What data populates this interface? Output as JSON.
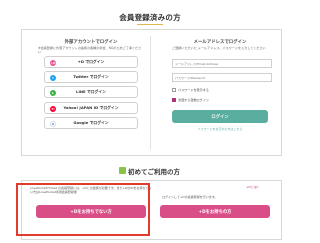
{
  "page": {
    "member_title": "会員登録済みの方",
    "first_title": "初めてご利用の方"
  },
  "external": {
    "heading": "外部アカウントでログイン",
    "desc": "※会員登録に外部アカウントの連携の各種の場合、NGのためご了承ください",
    "buttons": [
      {
        "label": "+D でログイン",
        "icon": "plus-d-icon",
        "color": "#e85a95",
        "glyph": "+D"
      },
      {
        "label": "Twitter でログイン",
        "icon": "twitter-icon",
        "color": "#1da1f2",
        "glyph": "t"
      },
      {
        "label": "LINE でログイン",
        "icon": "line-icon",
        "color": "#3cb44a",
        "glyph": "L"
      },
      {
        "label": "Yahoo! JAPAN ID でログイン",
        "icon": "yahoo-icon",
        "color": "#ff0033",
        "glyph": "Y!"
      },
      {
        "label": "Google でログイン",
        "icon": "google-icon",
        "color": "#ffffff",
        "glyph": "G"
      }
    ]
  },
  "email": {
    "heading": "メールアドレスでログイン",
    "desc": "ご登録いただいた メールアドレス、パスワードを入力してください",
    "email_placeholder": "メールアドレス/Email Address",
    "password_placeholder": "パスワード/Password",
    "show_password_label": "パスワードを表示する",
    "keep_login_label": "次回から自動ログイン",
    "login_button": "ログイン",
    "forgot_link": "パスワードをお忘れの方はこちら"
  },
  "first": {
    "left_text": "LovePocket!Ticket の会員登録には、+Dとの連携が必要です。まだ+DのIDをお持ちでない方はLovePocket専用会員登録後",
    "right_text": "ログインして+Dの会員登録を行います。",
    "link_text": "+Dとは?",
    "btn_no_id": "+Dをお持ちでない方",
    "btn_have_id": "+Dをお持ちの方"
  }
}
